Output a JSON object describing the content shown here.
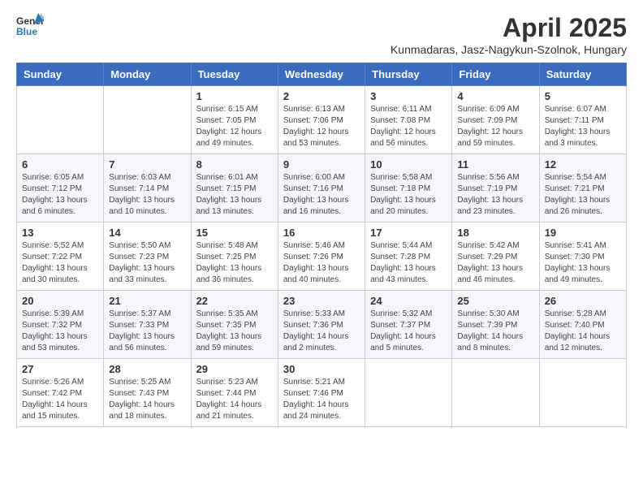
{
  "header": {
    "logo_general": "General",
    "logo_blue": "Blue",
    "title": "April 2025",
    "subtitle": "Kunmadaras, Jasz-Nagykun-Szolnok, Hungary"
  },
  "weekdays": [
    "Sunday",
    "Monday",
    "Tuesday",
    "Wednesday",
    "Thursday",
    "Friday",
    "Saturday"
  ],
  "weeks": [
    [
      {
        "day": "",
        "info": ""
      },
      {
        "day": "",
        "info": ""
      },
      {
        "day": "1",
        "info": "Sunrise: 6:15 AM\nSunset: 7:05 PM\nDaylight: 12 hours and 49 minutes."
      },
      {
        "day": "2",
        "info": "Sunrise: 6:13 AM\nSunset: 7:06 PM\nDaylight: 12 hours and 53 minutes."
      },
      {
        "day": "3",
        "info": "Sunrise: 6:11 AM\nSunset: 7:08 PM\nDaylight: 12 hours and 56 minutes."
      },
      {
        "day": "4",
        "info": "Sunrise: 6:09 AM\nSunset: 7:09 PM\nDaylight: 12 hours and 59 minutes."
      },
      {
        "day": "5",
        "info": "Sunrise: 6:07 AM\nSunset: 7:11 PM\nDaylight: 13 hours and 3 minutes."
      }
    ],
    [
      {
        "day": "6",
        "info": "Sunrise: 6:05 AM\nSunset: 7:12 PM\nDaylight: 13 hours and 6 minutes."
      },
      {
        "day": "7",
        "info": "Sunrise: 6:03 AM\nSunset: 7:14 PM\nDaylight: 13 hours and 10 minutes."
      },
      {
        "day": "8",
        "info": "Sunrise: 6:01 AM\nSunset: 7:15 PM\nDaylight: 13 hours and 13 minutes."
      },
      {
        "day": "9",
        "info": "Sunrise: 6:00 AM\nSunset: 7:16 PM\nDaylight: 13 hours and 16 minutes."
      },
      {
        "day": "10",
        "info": "Sunrise: 5:58 AM\nSunset: 7:18 PM\nDaylight: 13 hours and 20 minutes."
      },
      {
        "day": "11",
        "info": "Sunrise: 5:56 AM\nSunset: 7:19 PM\nDaylight: 13 hours and 23 minutes."
      },
      {
        "day": "12",
        "info": "Sunrise: 5:54 AM\nSunset: 7:21 PM\nDaylight: 13 hours and 26 minutes."
      }
    ],
    [
      {
        "day": "13",
        "info": "Sunrise: 5:52 AM\nSunset: 7:22 PM\nDaylight: 13 hours and 30 minutes."
      },
      {
        "day": "14",
        "info": "Sunrise: 5:50 AM\nSunset: 7:23 PM\nDaylight: 13 hours and 33 minutes."
      },
      {
        "day": "15",
        "info": "Sunrise: 5:48 AM\nSunset: 7:25 PM\nDaylight: 13 hours and 36 minutes."
      },
      {
        "day": "16",
        "info": "Sunrise: 5:46 AM\nSunset: 7:26 PM\nDaylight: 13 hours and 40 minutes."
      },
      {
        "day": "17",
        "info": "Sunrise: 5:44 AM\nSunset: 7:28 PM\nDaylight: 13 hours and 43 minutes."
      },
      {
        "day": "18",
        "info": "Sunrise: 5:42 AM\nSunset: 7:29 PM\nDaylight: 13 hours and 46 minutes."
      },
      {
        "day": "19",
        "info": "Sunrise: 5:41 AM\nSunset: 7:30 PM\nDaylight: 13 hours and 49 minutes."
      }
    ],
    [
      {
        "day": "20",
        "info": "Sunrise: 5:39 AM\nSunset: 7:32 PM\nDaylight: 13 hours and 53 minutes."
      },
      {
        "day": "21",
        "info": "Sunrise: 5:37 AM\nSunset: 7:33 PM\nDaylight: 13 hours and 56 minutes."
      },
      {
        "day": "22",
        "info": "Sunrise: 5:35 AM\nSunset: 7:35 PM\nDaylight: 13 hours and 59 minutes."
      },
      {
        "day": "23",
        "info": "Sunrise: 5:33 AM\nSunset: 7:36 PM\nDaylight: 14 hours and 2 minutes."
      },
      {
        "day": "24",
        "info": "Sunrise: 5:32 AM\nSunset: 7:37 PM\nDaylight: 14 hours and 5 minutes."
      },
      {
        "day": "25",
        "info": "Sunrise: 5:30 AM\nSunset: 7:39 PM\nDaylight: 14 hours and 8 minutes."
      },
      {
        "day": "26",
        "info": "Sunrise: 5:28 AM\nSunset: 7:40 PM\nDaylight: 14 hours and 12 minutes."
      }
    ],
    [
      {
        "day": "27",
        "info": "Sunrise: 5:26 AM\nSunset: 7:42 PM\nDaylight: 14 hours and 15 minutes."
      },
      {
        "day": "28",
        "info": "Sunrise: 5:25 AM\nSunset: 7:43 PM\nDaylight: 14 hours and 18 minutes."
      },
      {
        "day": "29",
        "info": "Sunrise: 5:23 AM\nSunset: 7:44 PM\nDaylight: 14 hours and 21 minutes."
      },
      {
        "day": "30",
        "info": "Sunrise: 5:21 AM\nSunset: 7:46 PM\nDaylight: 14 hours and 24 minutes."
      },
      {
        "day": "",
        "info": ""
      },
      {
        "day": "",
        "info": ""
      },
      {
        "day": "",
        "info": ""
      }
    ]
  ]
}
